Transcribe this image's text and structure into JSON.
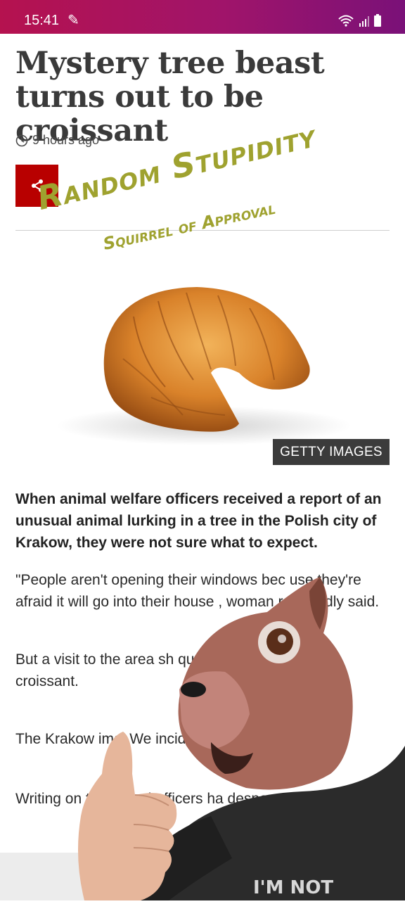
{
  "status_bar": {
    "time": "15:41"
  },
  "article": {
    "headline": "Mystery tree beast turns out to be croissant",
    "timestamp": "9 hours ago",
    "image_credit": "GETTY IMAGES",
    "lead": "When animal welfare officers received a report of an unusual animal lurking in a tree in the Polish city of Krakow, they were not sure what to expect.",
    "paragraphs": [
      "\"People aren't opening their windows bec use they're afraid it will go into their house , woman reportedly said.",
      "But a visit to the area sh question was not a bir a croissant.",
      "The Krakow imal We incident was uine.",
      "Writing on the organi officers ha despe unidentifi hic"
    ]
  },
  "overlay": {
    "title": "Random Stupidity",
    "subtitle": "Squirrel of Approval",
    "shirt_text": "I'M NOT"
  },
  "colors": {
    "accent": "#b80000",
    "overlay_text": "#9fa22f",
    "status_gradient_start": "#b5124f",
    "status_gradient_end": "#7a1178"
  }
}
